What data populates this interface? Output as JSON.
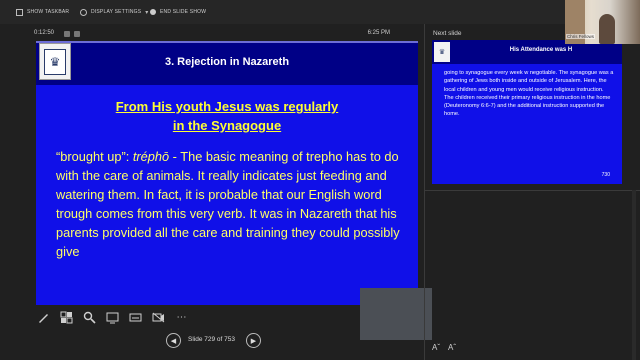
{
  "toolbar": {
    "show_taskbar": "SHOW TASKBAR",
    "display_settings": "DISPLAY SETTINGS",
    "end_slide_show": "END SLIDE SHOW"
  },
  "presenter": {
    "timer": "0:12:50",
    "clock": "6:25 PM"
  },
  "current_slide": {
    "title": "3.  Rejection in Nazareth",
    "subtitle_line1": "From His youth Jesus was regularly",
    "subtitle_line2": "in the Synagogue",
    "body_prefix": "“brought up”: ",
    "body_italic": "tréphō",
    "body_rest": " - The basic meaning of trepho has to do with the care of animals. It really indicates just feeding and watering them. In fact, it is probable that our English word trough comes from this very verb. It was in Nazareth that his parents provided all the care and training they could possibly give"
  },
  "navigation": {
    "slide_status": "Slide 729 of 753"
  },
  "next_slide": {
    "label": "Next slide",
    "title": "His Attendance was H",
    "body": "going to synagogue every week w negotiable. The synagogue was a gathering of Jews both inside and outside of Jerusalem. Here, the local children and young men would receive religious instruction. The children received their primary religious instruction in the home (Deuteronomy 6:6-7) and the additional instruction supported the home.",
    "number": "730"
  },
  "webcam": {
    "label": "Chris Fellows"
  },
  "colors": {
    "slide_bg": "#1010e8",
    "header_bg": "#000086",
    "title_text": "#ffffff",
    "subtitle_text": "#ffff33",
    "body_text": "#ffff66"
  }
}
